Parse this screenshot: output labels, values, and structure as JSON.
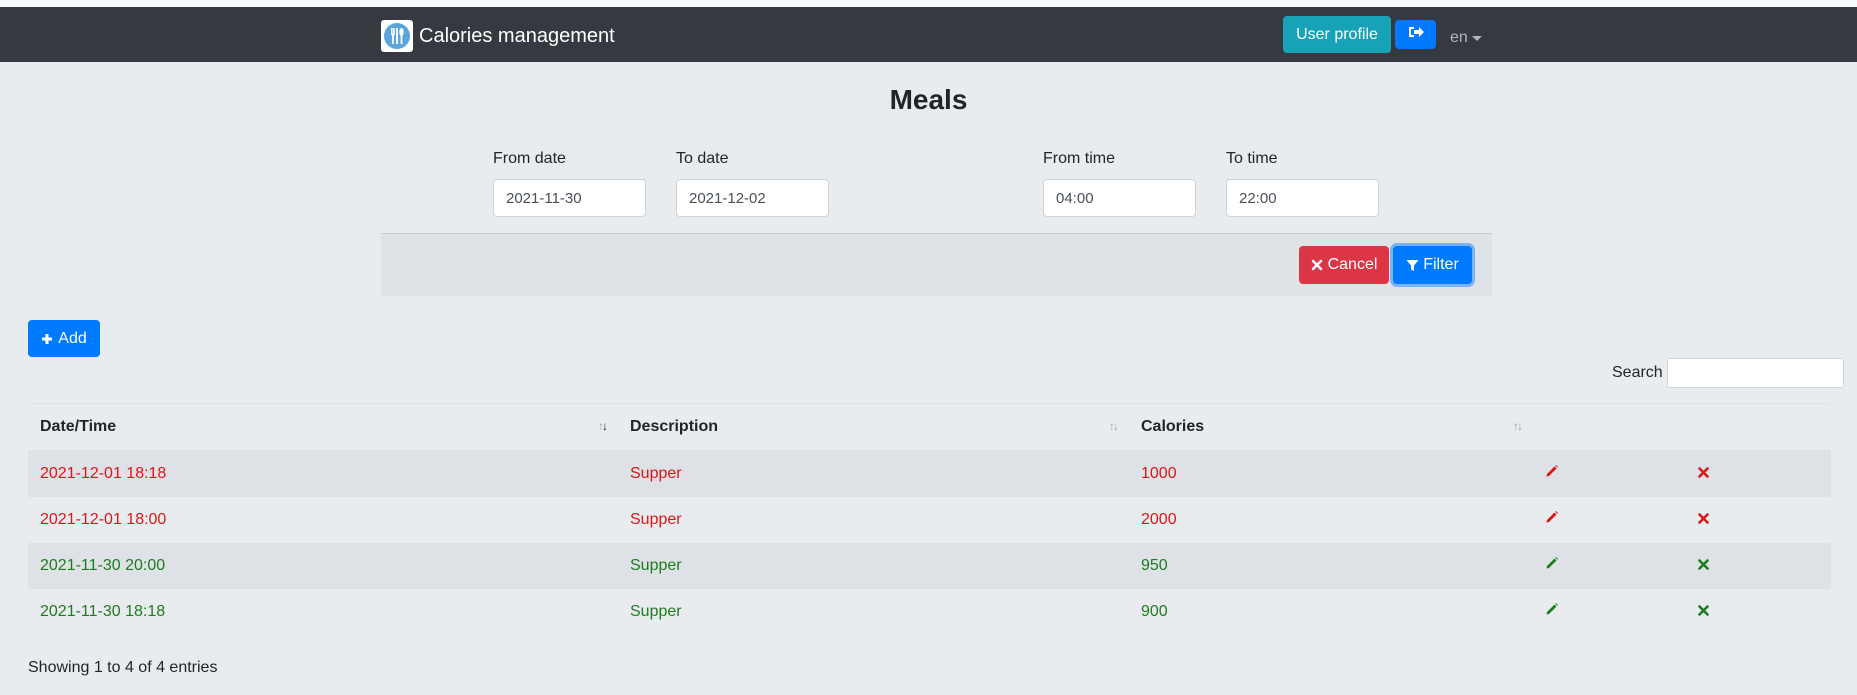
{
  "app": {
    "title": "Calories management"
  },
  "nav": {
    "profile_label": "User profile",
    "logout_icon": "sign-out-icon",
    "lang": "en"
  },
  "page": {
    "title": "Meals"
  },
  "filter": {
    "from_date_label": "From date",
    "from_date": "2021-11-30",
    "to_date_label": "To date",
    "to_date": "2021-12-02",
    "from_time_label": "From time",
    "from_time": "04:00",
    "to_time_label": "To time",
    "to_time": "22:00",
    "cancel_label": "Cancel",
    "filter_label": "Filter"
  },
  "actions": {
    "add_label": "Add"
  },
  "search": {
    "label": "Search",
    "value": ""
  },
  "table": {
    "columns": [
      "Date/Time",
      "Description",
      "Calories"
    ],
    "rows": [
      {
        "datetime": "2021-12-01 18:18",
        "description": "Supper",
        "calories": "1000",
        "excess": true
      },
      {
        "datetime": "2021-12-01 18:00",
        "description": "Supper",
        "calories": "2000",
        "excess": true
      },
      {
        "datetime": "2021-11-30 20:00",
        "description": "Supper",
        "calories": "950",
        "excess": false
      },
      {
        "datetime": "2021-11-30 18:18",
        "description": "Supper",
        "calories": "900",
        "excess": false
      }
    ],
    "info": "Showing 1 to 4 of 4 entries"
  },
  "colors": {
    "excess": "#dc1616",
    "normal": "#1d7d1d",
    "navbar": "#343a40",
    "primary": "#007bff",
    "danger": "#dc3545",
    "info": "#17a2b8"
  }
}
